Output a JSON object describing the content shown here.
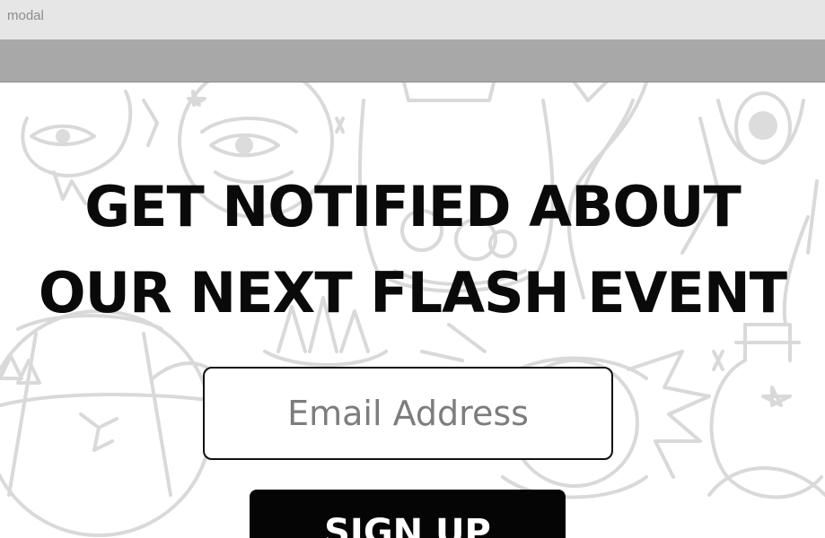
{
  "window": {
    "title": "modal"
  },
  "headline": {
    "line1": "GET NOTIFIED ABOUT",
    "line2": "OUR NEXT FLASH EVENT"
  },
  "form": {
    "email_placeholder": "Email Address",
    "email_value": "",
    "submit_label": "SIGN UP"
  },
  "colors": {
    "titlebar": "#e6e6e6",
    "header_bar": "#a8a8a8",
    "text": "#0a0a0a",
    "button_bg": "#050505",
    "button_text": "#ffffff",
    "art_lines": "#d9d9d9"
  }
}
